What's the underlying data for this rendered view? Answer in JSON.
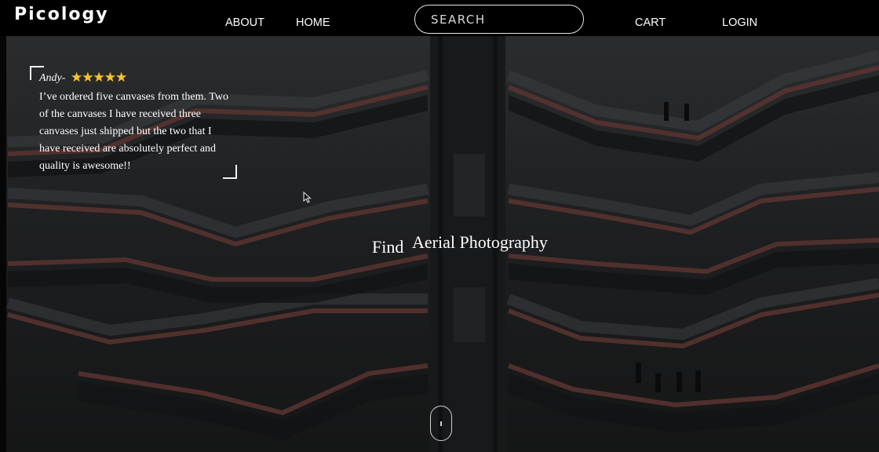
{
  "brand": {
    "logo_text": "Picology"
  },
  "nav": {
    "about": "ABOUT",
    "home": "HOME",
    "cart": "CART",
    "login": "LOGIN"
  },
  "search": {
    "placeholder": "SEARCH",
    "value": ""
  },
  "review": {
    "author": "Andy-",
    "rating": 5,
    "stars": "★★★★★",
    "text": "I’ve ordered five canvases from them. Two of the canvases I have received three canvases just shipped but the two that I have received are absolutely perfect and quality is awesome!!"
  },
  "hero": {
    "prefix": "Find",
    "rotating_word": "Aerial Photography"
  },
  "colors": {
    "navbar_bg": "#000000",
    "star": "#f6c234",
    "railing_accent": "#6b3a34"
  },
  "icons": {
    "cursor": "mouse-pointer-icon",
    "scroll": "scroll-mouse-icon",
    "star": "star-icon"
  }
}
